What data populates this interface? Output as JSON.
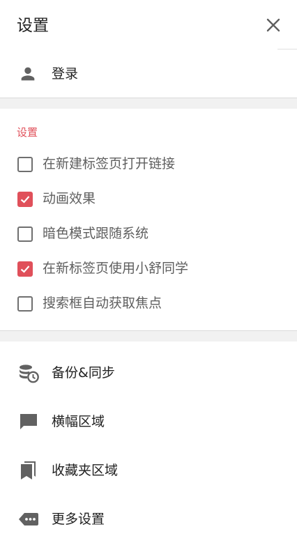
{
  "header": {
    "title": "设置"
  },
  "login": {
    "label": "登录",
    "icon": "person-icon"
  },
  "settings": {
    "section_label": "设置",
    "accent_color": "#e0505a",
    "options": [
      {
        "label": "在新建标签页打开链接",
        "checked": false
      },
      {
        "label": "动画效果",
        "checked": true
      },
      {
        "label": "暗色模式跟随系统",
        "checked": false
      },
      {
        "label": "在新标签页使用小舒同学",
        "checked": true
      },
      {
        "label": "搜索框自动获取焦点",
        "checked": false
      }
    ]
  },
  "menu": {
    "items": [
      {
        "label": "备份&同步",
        "icon": "database-clock-icon"
      },
      {
        "label": "横幅区域",
        "icon": "message-icon"
      },
      {
        "label": "收藏夹区域",
        "icon": "bookmarks-icon"
      },
      {
        "label": "更多设置",
        "icon": "label-more-icon"
      }
    ]
  }
}
